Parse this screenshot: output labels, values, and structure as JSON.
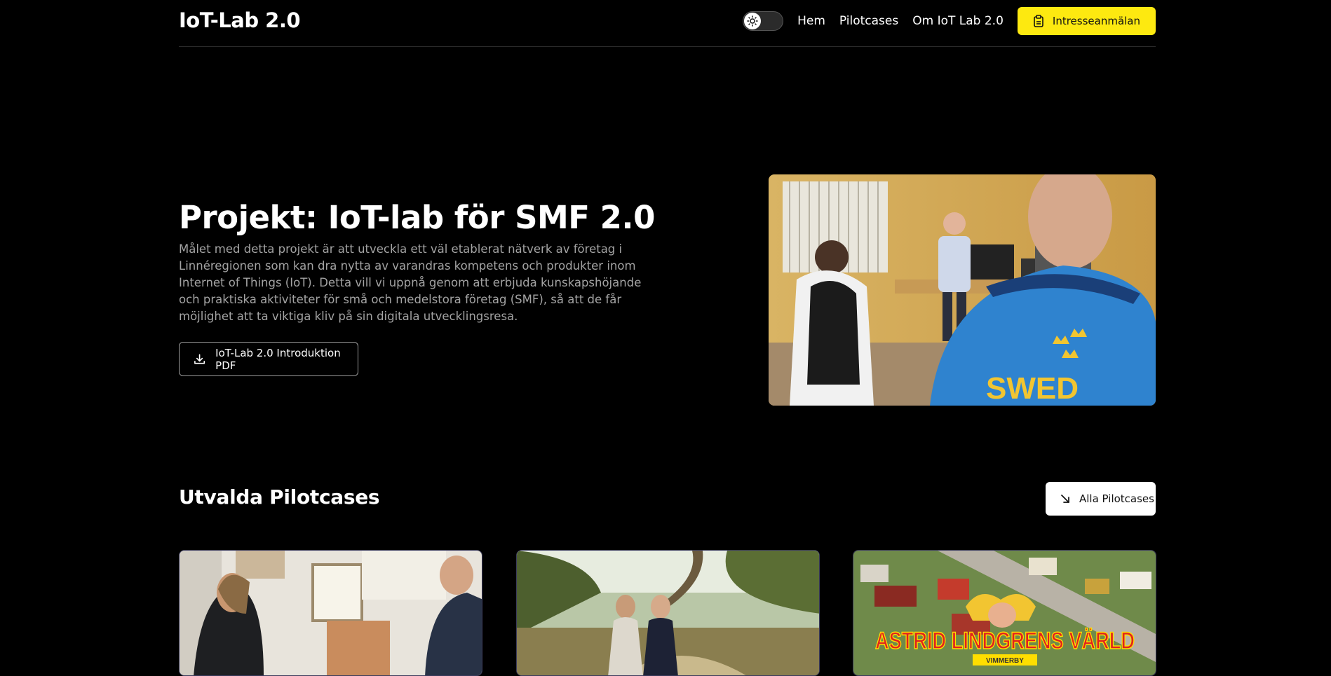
{
  "header": {
    "logo": "IoT-Lab 2.0",
    "nav": [
      "Hem",
      "Pilotcases",
      "Om IoT Lab 2.0"
    ],
    "cta_label": "Intresseanmälan",
    "theme_toggle_icon": "sun-icon"
  },
  "hero": {
    "title": "Projekt: IoT-lab för SMF 2.0",
    "description": "Målet med detta projekt är att utveckla ett väl etablerat nätverk av företag i Linnéregionen som kan dra nytta av varandras kompetens och produkter inom Internet of Things (IoT). Detta vill vi uppnå genom att erbjuda kunskapshöjande och praktiska aktiviteter för små och medelstora företag (SMF), så att de får möjlighet att ta viktiga kliv på sin digitala utvecklingsresa.",
    "pdf_button": "IoT-Lab 2.0 Introduktion PDF",
    "image_sign_text": "SWED"
  },
  "featured": {
    "title": "Utvalda Pilotcases",
    "all_button": "Alla Pilotcases",
    "cards": [
      {
        "name": "pilotcase-shop"
      },
      {
        "name": "pilotcase-forest"
      },
      {
        "name": "pilotcase-astrid",
        "sign_text": "ASTRID LINDGRENS VÄRLD",
        "sign_subtext": "VIMMERBY"
      }
    ]
  },
  "colors": {
    "background": "#000000",
    "accent": "#fde910",
    "muted_text": "#a3a3a3"
  }
}
